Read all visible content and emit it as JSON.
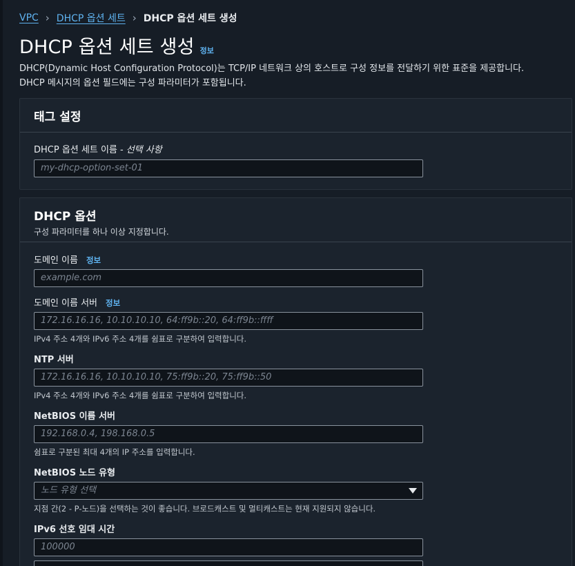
{
  "breadcrumb": {
    "items": [
      {
        "label": "VPC"
      },
      {
        "label": "DHCP 옵션 세트"
      }
    ],
    "current": "DHCP 옵션 세트 생성",
    "separator": "›"
  },
  "header": {
    "title": "DHCP 옵션 세트 생성",
    "info": "정보",
    "description_line1": "DHCP(Dynamic Host Configuration Protocol)는 TCP/IP 네트워크 상의 호스트로 구성 정보를 전달하기 위한 표준을 제공합니다.",
    "description_line2": "DHCP 메시지의 옵션 필드에는 구성 파라미터가 포함됩니다."
  },
  "tag_settings": {
    "title": "태그 설정",
    "name_label": "DHCP 옵션 세트 이름 -",
    "name_optional": "선택 사항",
    "name_placeholder": "my-dhcp-option-set-01"
  },
  "dhcp_options": {
    "title": "DHCP 옵션",
    "subtitle": "구성 파라미터를 하나 이상 지정합니다.",
    "domain_name": {
      "label": "도메인 이름",
      "info": "정보",
      "placeholder": "example.com"
    },
    "domain_name_servers": {
      "label": "도메인 이름 서버",
      "info": "정보",
      "placeholder": "172.16.16.16, 10.10.10.10, 64:ff9b::20, 64:ff9b::ffff",
      "hint": "IPv4 주소 4개와 IPv6 주소 4개를 쉼표로 구분하여 입력합니다."
    },
    "ntp_servers": {
      "label": "NTP 서버",
      "placeholder": "172.16.16.16, 10.10.10.10, 75:ff9b::20, 75:ff9b::50",
      "hint": "IPv4 주소 4개와 IPv6 주소 4개를 쉼표로 구분하여 입력합니다."
    },
    "netbios_name_servers": {
      "label": "NetBIOS 이름 서버",
      "placeholder": "192.168.0.4, 198.168.0.5",
      "hint": "쉼표로 구분된 최대 4개의 IP 주소를 입력합니다."
    },
    "netbios_node_type": {
      "label": "NetBIOS 노드 유형",
      "placeholder": "노드 유형 선택",
      "hint": "지점 간(2 - P-노드)을 선택하는 것이 좋습니다. 브로드캐스트 및 멀티캐스트는 현재 지원되지 않습니다."
    },
    "ipv6_lease_time": {
      "label": "IPv6 선호 임대 시간",
      "placeholder": "100000"
    }
  },
  "colors": {
    "background": "#161d26",
    "panel": "#1b232d",
    "link": "#5fb3f0",
    "input_border": "#8a939e"
  },
  "icons": {
    "breadcrumb_separator": "chevron-right-icon",
    "select_caret": "caret-down-icon"
  }
}
